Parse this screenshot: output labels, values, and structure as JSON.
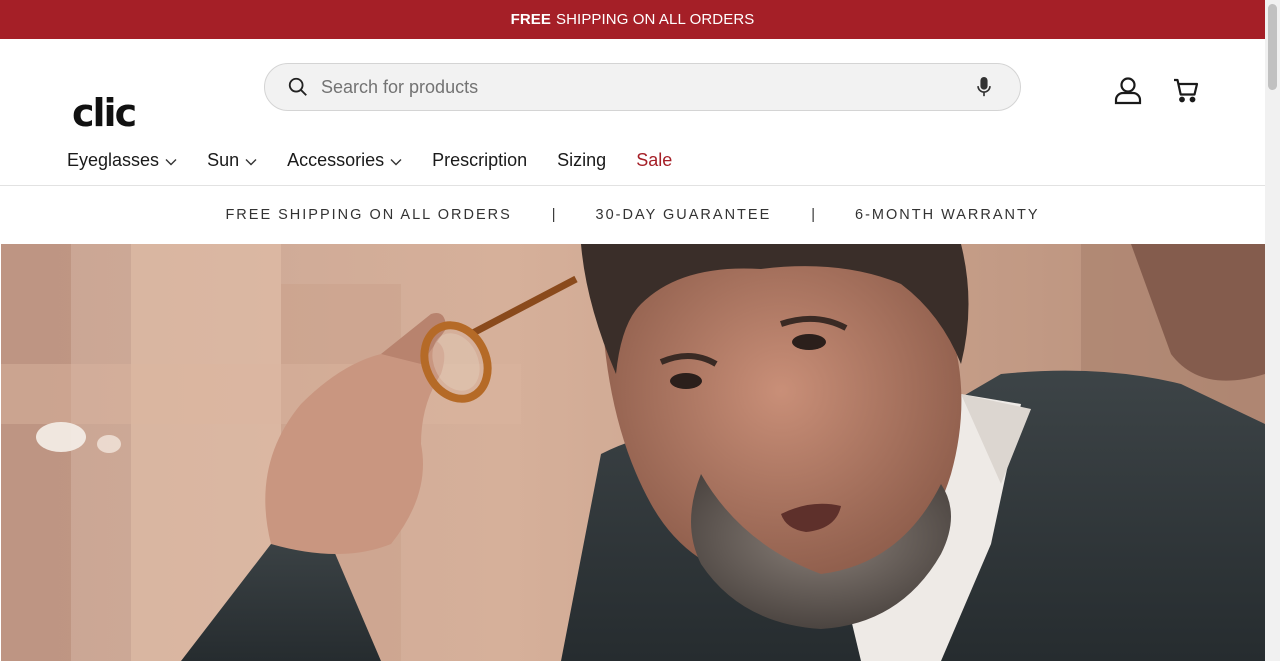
{
  "announcement": {
    "bold": "FREE",
    "text": "SHIPPING ON ALL ORDERS"
  },
  "header": {
    "logo_text": "clic",
    "search": {
      "placeholder": "Search for products",
      "value": ""
    },
    "account_icon": "user-icon",
    "cart_icon": "cart-icon"
  },
  "nav": {
    "items": [
      {
        "label": "Eyeglasses",
        "has_dropdown": true
      },
      {
        "label": "Sun",
        "has_dropdown": true
      },
      {
        "label": "Accessories",
        "has_dropdown": true
      },
      {
        "label": "Prescription",
        "has_dropdown": false
      },
      {
        "label": "Sizing",
        "has_dropdown": false
      },
      {
        "label": "Sale",
        "has_dropdown": false
      }
    ]
  },
  "usp": {
    "items": [
      "FREE SHIPPING ON ALL ORDERS",
      "30-DAY GUARANTEE",
      "6-MONTH WARRANTY"
    ],
    "separator": "|"
  },
  "colors": {
    "brand_red": "#a51f27",
    "sale_red": "#a51f27",
    "search_bg": "#f2f2f2"
  }
}
